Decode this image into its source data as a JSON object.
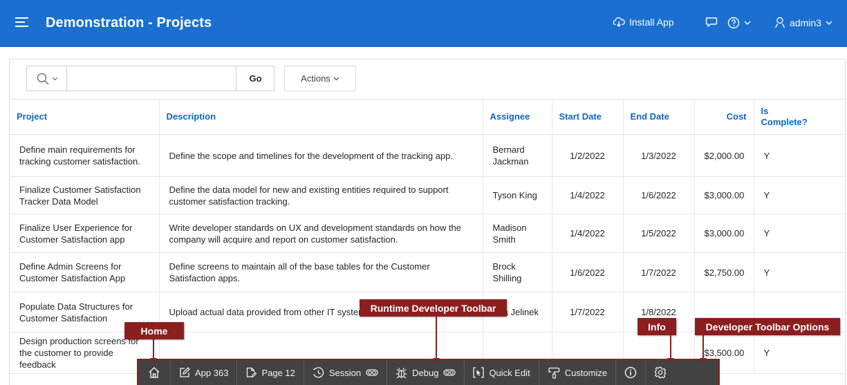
{
  "header": {
    "title": "Demonstration - Projects",
    "install_app": "Install App",
    "user": "admin3"
  },
  "report": {
    "search_value": "",
    "go_label": "Go",
    "actions_label": "Actions",
    "columns": [
      "Project",
      "Description",
      "Assignee",
      "Start Date",
      "End Date",
      "Cost",
      "Is Complete?"
    ],
    "rows": [
      {
        "project": "Define main requirements for tracking customer satisfaction.",
        "description": "Define the scope and timelines for the development of the tracking app.",
        "assignee": "Bernard Jackman",
        "start": "1/2/2022",
        "end": "1/3/2022",
        "cost": "$2,000.00",
        "complete": "Y"
      },
      {
        "project": "Finalize Customer Satisfaction Tracker Data Model",
        "description": "Define the data model for new and existing entities required to support customer satisfaction tracking.",
        "assignee": "Tyson King",
        "start": "1/4/2022",
        "end": "1/6/2022",
        "cost": "$3,000.00",
        "complete": "Y"
      },
      {
        "project": "Finalize User Experience for Customer Satisfaction app",
        "description": "Write developer standards on UX and development standards on how the company will acquire and report on customer satisfaction.",
        "assignee": "Madison Smith",
        "start": "1/4/2022",
        "end": "1/5/2022",
        "cost": "$3,000.00",
        "complete": "Y"
      },
      {
        "project": "Define Admin Screens for Customer Satisfaction App",
        "description": "Define screens to maintain all of the base tables for the Customer Satisfaction apps.",
        "assignee": "Brock Shilling",
        "start": "1/6/2022",
        "end": "1/7/2022",
        "cost": "$2,750.00",
        "complete": "Y"
      },
      {
        "project": "Populate Data Structures for Customer Satisfaction",
        "description": "Upload actual data provided from other IT systems.",
        "assignee": "Eva Jelinek",
        "start": "1/7/2022",
        "end": "1/8/2022",
        "cost": "",
        "complete": ""
      },
      {
        "project": "Design production screens for the customer to provide feedback",
        "description": "",
        "assignee": "",
        "start": "",
        "end": "",
        "cost": "$3,500.00",
        "complete": "Y"
      }
    ]
  },
  "dev_toolbar": {
    "app": "App 363",
    "page": "Page 12",
    "session": "Session",
    "debug": "Debug",
    "quick_edit": "Quick Edit",
    "customize": "Customize"
  },
  "callouts": {
    "home": "Home",
    "runtime": "Runtime Developer Toolbar",
    "info": "Info",
    "options": "Developer Toolbar Options"
  },
  "icons": {
    "menu": "hamburger-menu-icon",
    "install": "cloud-download-icon",
    "chat": "chat-bubble-icon",
    "help": "help-circle-icon",
    "user": "user-icon",
    "search": "search-icon",
    "home": "home-icon",
    "app": "edit-icon",
    "page": "page-edit-icon",
    "session": "clock-icon",
    "debug": "bug-icon",
    "quick_edit": "cursor-select-icon",
    "customize": "brush-icon",
    "info": "info-circle-icon",
    "options": "gear-icon"
  },
  "colors": {
    "header": "#1a6fd0",
    "column_header": "#0e66c4",
    "toolbar": "#424242",
    "callout": "#8b1f1f"
  }
}
